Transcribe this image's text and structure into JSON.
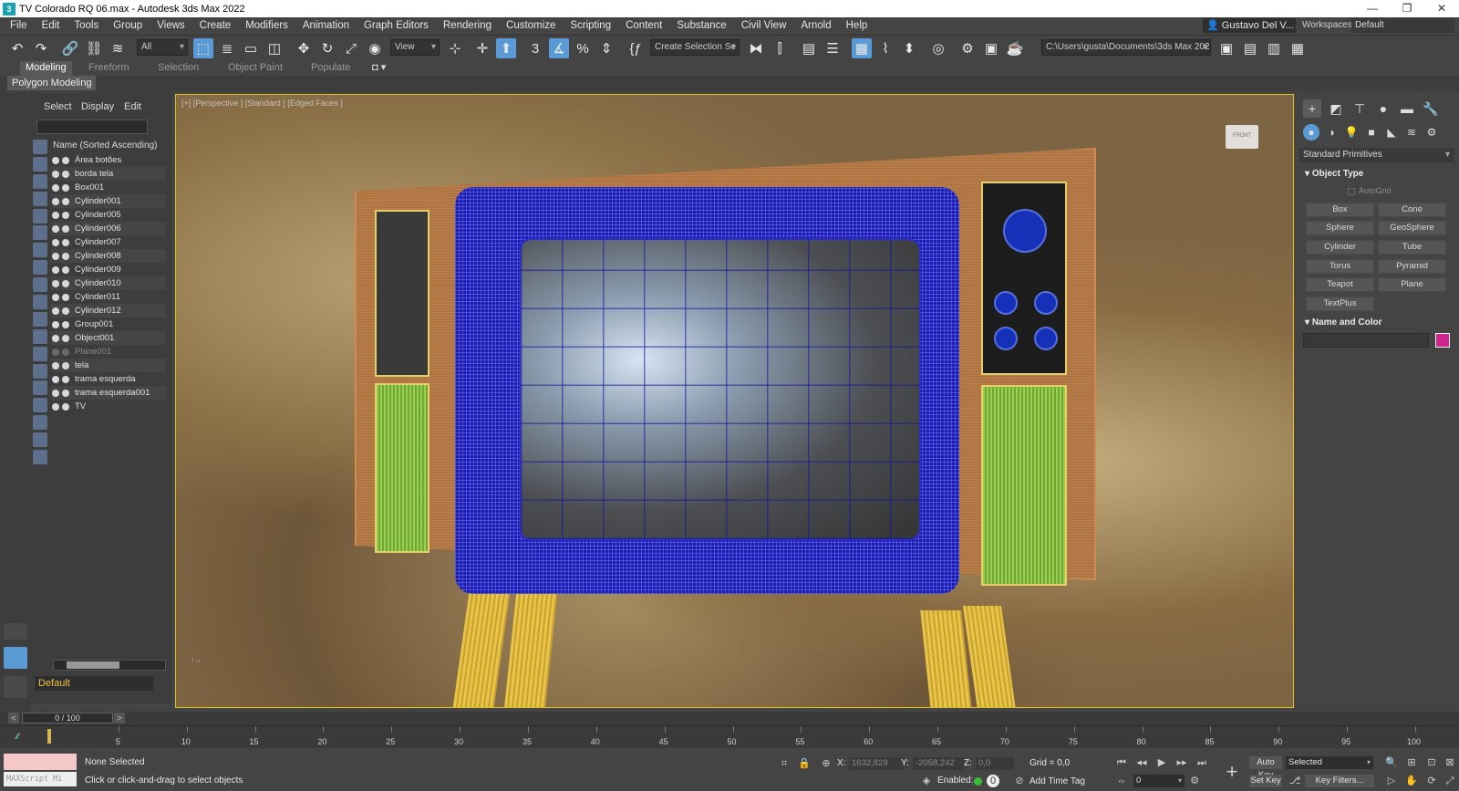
{
  "window": {
    "title": "TV Colorado RQ 06.max - Autodesk 3ds Max 2022",
    "controls": [
      "—",
      "❐",
      "✕"
    ]
  },
  "menu": {
    "items": [
      "File",
      "Edit",
      "Tools",
      "Group",
      "Views",
      "Create",
      "Modifiers",
      "Animation",
      "Graph Editors",
      "Rendering",
      "Customize",
      "Scripting",
      "Content",
      "Substance",
      "Civil View",
      "Arnold",
      "Help"
    ],
    "user": "Gustavo Del V...",
    "workspaces_label": "Workspaces:",
    "workspaces_value": "Default"
  },
  "toolbar": {
    "selection_filter": "All",
    "reference_coord": "View",
    "named_selection": "Create Selection Se",
    "project_path": "C:\\Users\\gusta\\Documents\\3ds Max 2022"
  },
  "ribbon": {
    "tabs": [
      "Modeling",
      "Freeform",
      "Selection",
      "Object Paint",
      "Populate"
    ],
    "active_tab": "Modeling",
    "panel": "Polygon Modeling"
  },
  "explorer": {
    "tabs": [
      "Select",
      "Display",
      "Edit"
    ],
    "column_header": "Name (Sorted Ascending)",
    "items": [
      {
        "name": "Área botões",
        "hidden": false
      },
      {
        "name": "borda tela",
        "hidden": false
      },
      {
        "name": "Box001",
        "hidden": false
      },
      {
        "name": "Cylinder001",
        "hidden": false
      },
      {
        "name": "Cylinder005",
        "hidden": false
      },
      {
        "name": "Cylinder006",
        "hidden": false
      },
      {
        "name": "Cylinder007",
        "hidden": false
      },
      {
        "name": "Cylinder008",
        "hidden": false
      },
      {
        "name": "Cylinder009",
        "hidden": false
      },
      {
        "name": "Cylinder010",
        "hidden": false
      },
      {
        "name": "Cylinder011",
        "hidden": false
      },
      {
        "name": "Cylinder012",
        "hidden": false
      },
      {
        "name": "Group001",
        "hidden": false
      },
      {
        "name": "Object001",
        "hidden": false
      },
      {
        "name": "Plane001",
        "hidden": true
      },
      {
        "name": "tela",
        "hidden": false
      },
      {
        "name": "trama esquerda",
        "hidden": false
      },
      {
        "name": "trama esquerda001",
        "hidden": false
      },
      {
        "name": "TV",
        "hidden": false
      }
    ],
    "layer": "Default"
  },
  "viewport": {
    "label": "[+] [Perspective ] [Standard ] [Edged Faces ]",
    "viewcube_label": "FRONT"
  },
  "command_panel": {
    "category": "Standard Primitives",
    "object_type_title": "Object Type",
    "autogrid": "AutoGrid",
    "buttons": [
      "Box",
      "Cone",
      "Sphere",
      "GeoSphere",
      "Cylinder",
      "Tube",
      "Torus",
      "Pyramid",
      "Teapot",
      "Plane",
      "TextPlus"
    ],
    "name_color_title": "Name and Color",
    "object_color": "#d0258a"
  },
  "timeline": {
    "frame_display": "0 / 100",
    "ticks": [
      "5",
      "10",
      "15",
      "20",
      "25",
      "30",
      "35",
      "40",
      "45",
      "50",
      "55",
      "60",
      "65",
      "70",
      "75",
      "80",
      "85",
      "90",
      "95",
      "100"
    ]
  },
  "status": {
    "maxscript_placeholder": "MAXScript Mi",
    "selection": "None Selected",
    "prompt": "Click or click-and-drag to select objects",
    "x_label": "X:",
    "x_value": "1632,829",
    "y_label": "Y:",
    "y_value": "-2058,242",
    "z_label": "Z:",
    "z_value": "0,0",
    "grid": "Grid = 0,0",
    "enabled_label": "Enabled:",
    "add_time_tag": "Add Time Tag",
    "auto_key": "Auto Key",
    "set_key": "Set Key",
    "key_mode": "Selected",
    "current_frame": "0",
    "key_filters": "Key Filters..."
  },
  "colors": {
    "accent": "#5b9bd5",
    "viewport_border": "#e0c020",
    "layer_text": "#f0c040"
  }
}
